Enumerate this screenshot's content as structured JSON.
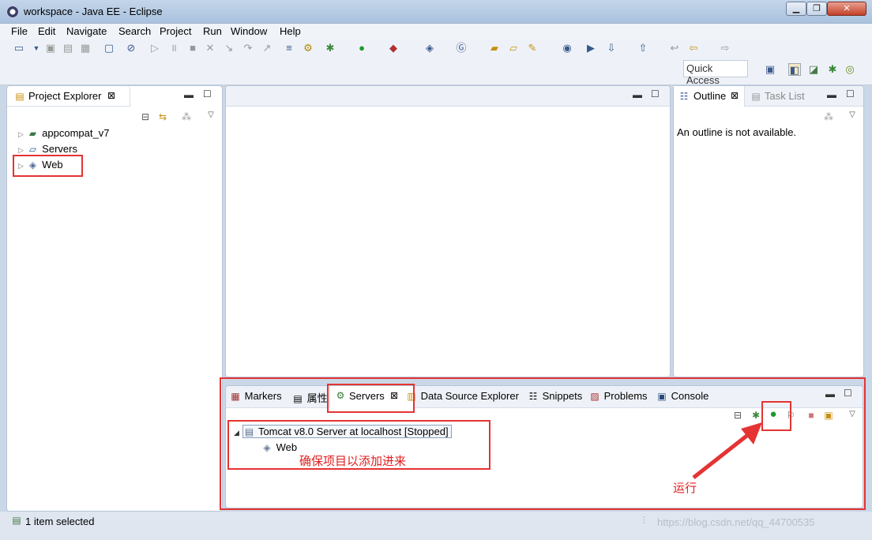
{
  "window": {
    "title": "workspace - Java EE - Eclipse",
    "btn_min": "▁",
    "btn_max": "❐",
    "btn_close": "✕"
  },
  "menu": [
    "File",
    "Edit",
    "Navigate",
    "Search",
    "Project",
    "Run",
    "Window",
    "Help"
  ],
  "toolbar": {
    "quick_access": "Quick Access"
  },
  "project_explorer": {
    "tab_label": "Project Explorer",
    "items": [
      {
        "label": "appcompat_v7",
        "icon": "project-icon"
      },
      {
        "label": "Servers",
        "icon": "folder-icon"
      },
      {
        "label": "Web",
        "icon": "web-project-icon"
      }
    ]
  },
  "outline": {
    "tab_label": "Outline",
    "tab2_label": "Task List",
    "message": "An outline is not available."
  },
  "bottom_tabs": [
    "Markers",
    "属性",
    "Servers",
    "Data Source Explorer",
    "Snippets",
    "Problems",
    "Console"
  ],
  "servers": {
    "server_label": "Tomcat v8.0 Server at localhost  [Stopped]",
    "child_label": "Web",
    "note_added": "确保项目以添加进来",
    "note_run": "运行"
  },
  "status": {
    "text": "1 item selected",
    "watermark": "https://blog.csdn.net/qq_44700535"
  },
  "colors": {
    "accent": "#e53333"
  }
}
